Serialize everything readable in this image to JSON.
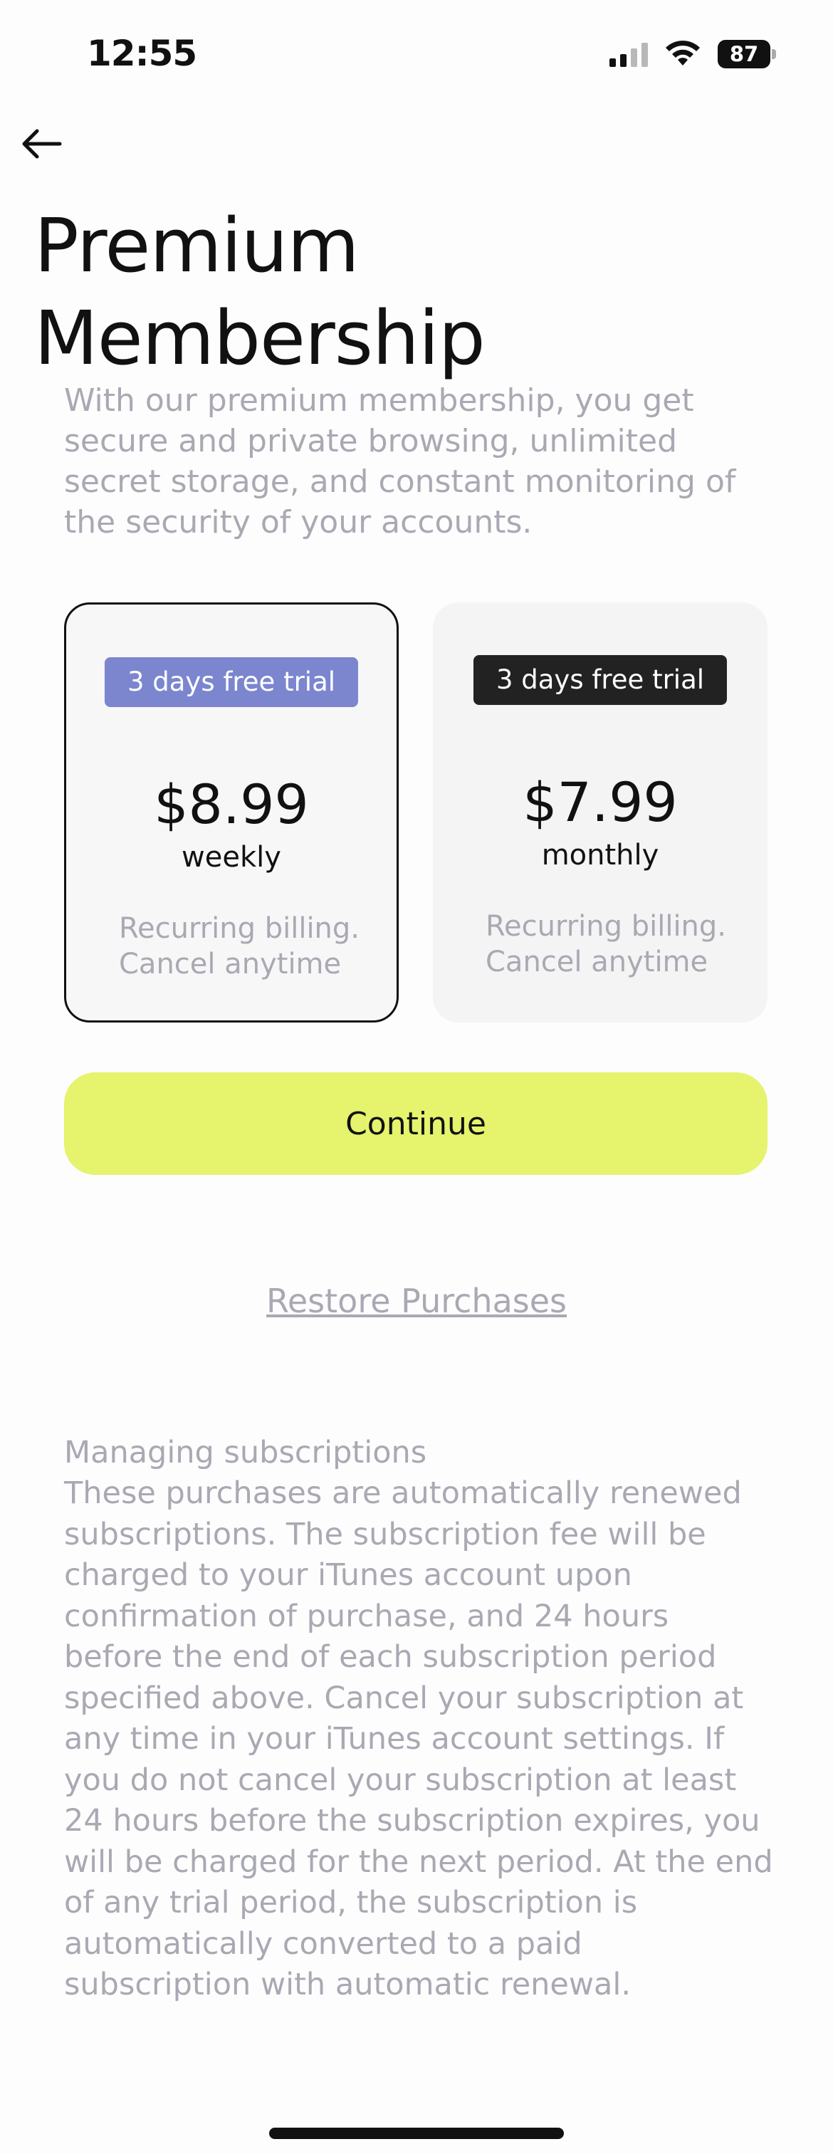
{
  "status_bar": {
    "time": "12:55",
    "battery": "87"
  },
  "header": {
    "title": "Premium Membership"
  },
  "intro": "With our premium membership, you get secure and private browsing, unlimited secret storage, and constant monitoring of the security of your accounts.",
  "plans": [
    {
      "badge": "3 days free trial",
      "price": "$8.99",
      "period": "weekly",
      "note": "Recurring billing. Cancel anytime",
      "selected": true,
      "badge_color": "#7b86cf"
    },
    {
      "badge": "3 days free trial",
      "price": "$7.99",
      "period": "monthly",
      "note": "Recurring billing. Cancel anytime",
      "selected": false,
      "badge_color": "#222222"
    }
  ],
  "actions": {
    "continue_label": "Continue",
    "restore_label": "Restore Purchases"
  },
  "legal": {
    "heading": "Managing subscriptions",
    "body": "These purchases are automatically renewed subscriptions. The subscription fee will be charged to your iTunes account upon confirmation of purchase, and 24 hours before the end of each subscription period specified above. Cancel your subscription at any time in your iTunes account settings. If you do not cancel your subscription at least 24 hours before the subscription expires, you will be charged for the next period. At the end of any trial period, the subscription is automatically converted to a paid subscription with automatic renewal."
  },
  "colors": {
    "accent": "#e5f36d",
    "muted_text": "#a9a9b3",
    "selected_badge": "#7b86cf"
  },
  "icons": {
    "back": "arrow-left-icon",
    "signal": "cellular-signal-icon",
    "wifi": "wifi-icon",
    "battery": "battery-icon"
  }
}
